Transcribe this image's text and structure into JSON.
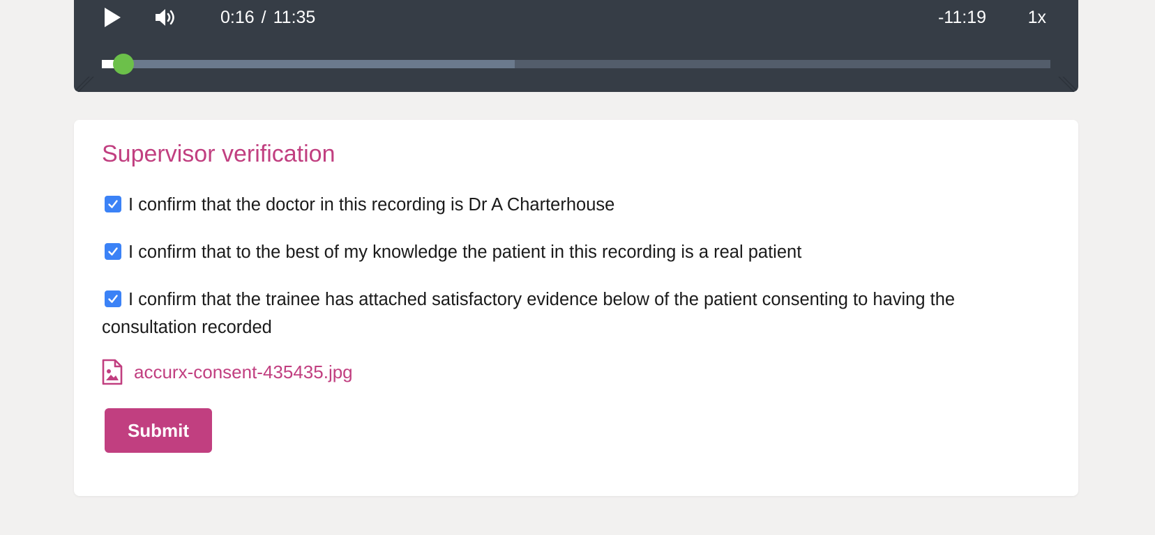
{
  "player": {
    "play_icon": "play-icon",
    "volume_icon": "volume-icon",
    "current_time": "0:16",
    "separator": "/",
    "duration": "11:35",
    "remaining": "-11:19",
    "speed": "1x",
    "progress": {
      "played_fraction": 0.023,
      "buffered_fraction": 0.435
    },
    "colors": {
      "background": "#363d46",
      "handle": "#6cc04a",
      "track": "#535d6b",
      "buffered": "#6b7a8d"
    }
  },
  "verification": {
    "title": "Supervisor verification",
    "checks": [
      {
        "label": "I confirm that the doctor in this recording is Dr A Charterhouse",
        "checked": true
      },
      {
        "label": "I confirm that to the best of my knowledge the patient in this recording is a real patient",
        "checked": true
      },
      {
        "label": "I confirm that the trainee has attached satisfactory evidence below of the patient consenting to having the consultation recorded",
        "checked": true
      }
    ],
    "attachment": {
      "icon": "file-image-icon",
      "filename": "accurx-consent-435435.jpg"
    },
    "submit_label": "Submit",
    "colors": {
      "accent": "#c13f80",
      "checkbox": "#3b82f6"
    }
  }
}
